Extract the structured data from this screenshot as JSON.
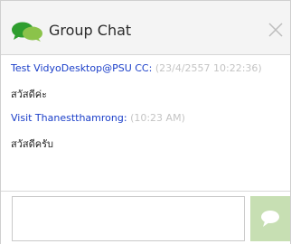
{
  "window": {
    "title": "Group Chat"
  },
  "icons": {
    "chat": "chat-bubbles-icon",
    "close": "close-icon",
    "send": "speech-bubble-icon"
  },
  "colors": {
    "accent_green": "#2e9e2e",
    "sender_blue": "#1b3fc9",
    "timestamp_gray": "#c4c4c4",
    "send_button_bg": "#c7dfb3"
  },
  "messages": [
    {
      "sender": "Test VidyoDesktop@PSU CC:",
      "time": "(23/4/2557 10:22:36)",
      "text": "สวัสดีค่ะ"
    },
    {
      "sender": "Visit Thanestthamrong:",
      "time": "(10:23 AM)",
      "text": "สวัสดีครับ"
    }
  ],
  "composer": {
    "value": "",
    "placeholder": ""
  }
}
